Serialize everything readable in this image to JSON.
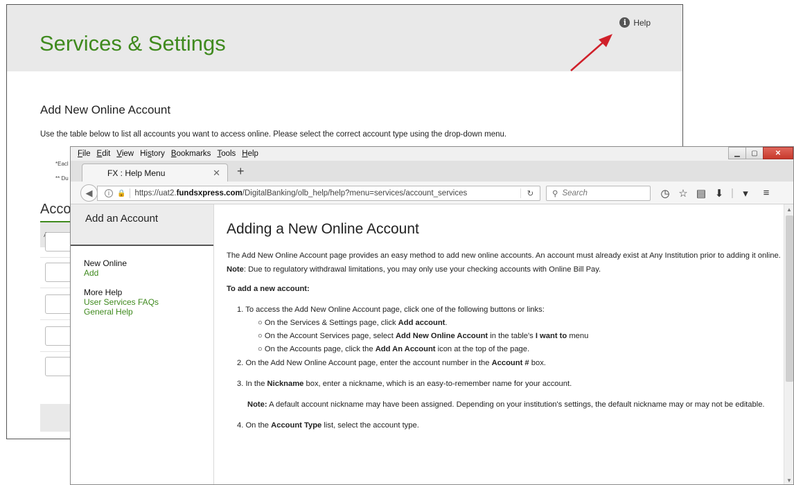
{
  "background_page": {
    "title": "Services & Settings",
    "help_label": "Help",
    "section_title": "Add New Online Account",
    "section_desc": "Use the table below to list all accounts you want to access online. Please select the correct account type using the drop-down menu.",
    "footnote1": "*Eacl",
    "footnote2": "** Du",
    "accounts_title": "Acco",
    "table_head": "Accour",
    "brand_color": "#3f8a1e"
  },
  "browser": {
    "menu": [
      {
        "label": "File",
        "accel": "F"
      },
      {
        "label": "Edit",
        "accel": "E"
      },
      {
        "label": "View",
        "accel": "V"
      },
      {
        "label": "History",
        "accel": "s"
      },
      {
        "label": "Bookmarks",
        "accel": "B"
      },
      {
        "label": "Tools",
        "accel": "T"
      },
      {
        "label": "Help",
        "accel": "H"
      }
    ],
    "tab_title": "FX : Help Menu",
    "url_prefix": "https://uat2.",
    "url_domain": "fundsxpress.com",
    "url_path": "/DigitalBanking/olb_help/help?menu=services/account_services",
    "search_placeholder": "Search"
  },
  "sidebar": {
    "header": "Add an Account",
    "group1_title": "New Online",
    "group1_link": "Add",
    "group2_title": "More Help",
    "group2_links": [
      "User Services FAQs",
      "General Help"
    ]
  },
  "help": {
    "title": "Adding a New Online Account",
    "intro": "The Add New Online Account page provides an easy method to add new online accounts. An account must already exist at Any Institution prior to adding it online.",
    "note_label": "Note",
    "note_text": ": Due to regulatory withdrawal limitations, you may only use your checking accounts with Online Bill Pay.",
    "section_head": "To add a new account:",
    "step1": "1. To access the Add New Online Account page, click one of the following buttons or links:",
    "sub1_pre": "On the Services & Settings page, click ",
    "sub1_bold": "Add account",
    "sub1_post": ".",
    "sub2_pre": "On the Account Services page, select ",
    "sub2_bold1": "Add New Online Account",
    "sub2_mid": " in the table's ",
    "sub2_bold2": "I want to",
    "sub2_post": " menu",
    "sub3_pre": "On the Accounts page, click the ",
    "sub3_bold": "Add An Account",
    "sub3_post": " icon at the top of the page.",
    "step2_pre": "2. On the Add New Online Account page, enter the account number in the ",
    "step2_bold": "Account #",
    "step2_post": " box.",
    "step3_pre": "3. In the ",
    "step3_bold": "Nickname",
    "step3_post": " box, enter a nickname, which is an easy-to-remember name for your account.",
    "note2_label": "Note:",
    "note2_text": " A default account nickname may have been assigned. Depending on your institution's settings, the default nickname may or may not be editable.",
    "step4_pre": "4. On the ",
    "step4_bold": "Account Type",
    "step4_post": " list, select the account type."
  }
}
